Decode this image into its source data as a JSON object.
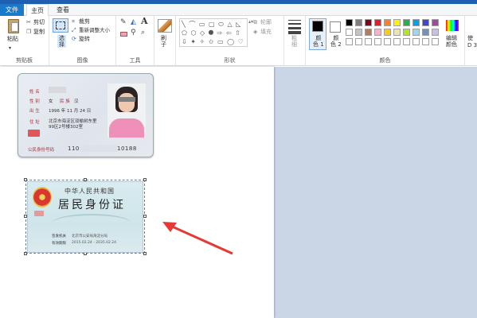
{
  "tabs": {
    "file": "文件",
    "home": "主页",
    "view": "查看"
  },
  "clipboard": {
    "paste": "粘贴",
    "cut": "剪切",
    "copy": "复制",
    "label": "剪贴板"
  },
  "image": {
    "select": "选\n择",
    "crop": "裁剪",
    "resize": "重新调整大小",
    "rotate": "旋转",
    "label": "图像"
  },
  "tools": {
    "label": "工具",
    "text_tool": "A"
  },
  "brushes": {
    "label": "刷\n子"
  },
  "shapes": {
    "outline": "轮廓",
    "fill": "填充",
    "label": "形状"
  },
  "size": {
    "label": "粗\n细"
  },
  "colors": {
    "color1": "颜\n色 1",
    "color2": "颜\n色 2",
    "edit": "编辑\n颜色",
    "label": "颜色",
    "extra": "使\nD 3",
    "palette_row1": [
      "#000000",
      "#7f7f7f",
      "#880015",
      "#ed1c24",
      "#ff7f27",
      "#fff200",
      "#22b14c",
      "#00a2e8",
      "#3f48cc",
      "#a349a4"
    ],
    "palette_row2": [
      "#ffffff",
      "#c3c3c3",
      "#b97a57",
      "#ffaec9",
      "#ffc90e",
      "#efe4b0",
      "#b5e61d",
      "#99d9ea",
      "#7092be",
      "#c8bfe7"
    ]
  },
  "card_front": {
    "name_label": "姓 名",
    "sex_label": "性 别",
    "sex_value": "女",
    "ethnicity_label": "民 族",
    "ethnicity_value": "汉",
    "birth_label": "出 生",
    "birth_value": "1996 年 11 月 24 日",
    "address_label": "住 址",
    "address_value1": "北京市海淀区双榆树东里",
    "address_value2": "99区2号楼302室",
    "id_label": "公民身份号码",
    "id_value_start": "110",
    "id_value_end": "10188"
  },
  "card_back": {
    "country": "中华人民共和国",
    "title": "居民身份证",
    "authority_label": "签发机关",
    "authority_value": "北京市公安局海淀分局",
    "validity_label": "有效期限",
    "validity_value": "2015.02.24 - 2035.02.24"
  }
}
